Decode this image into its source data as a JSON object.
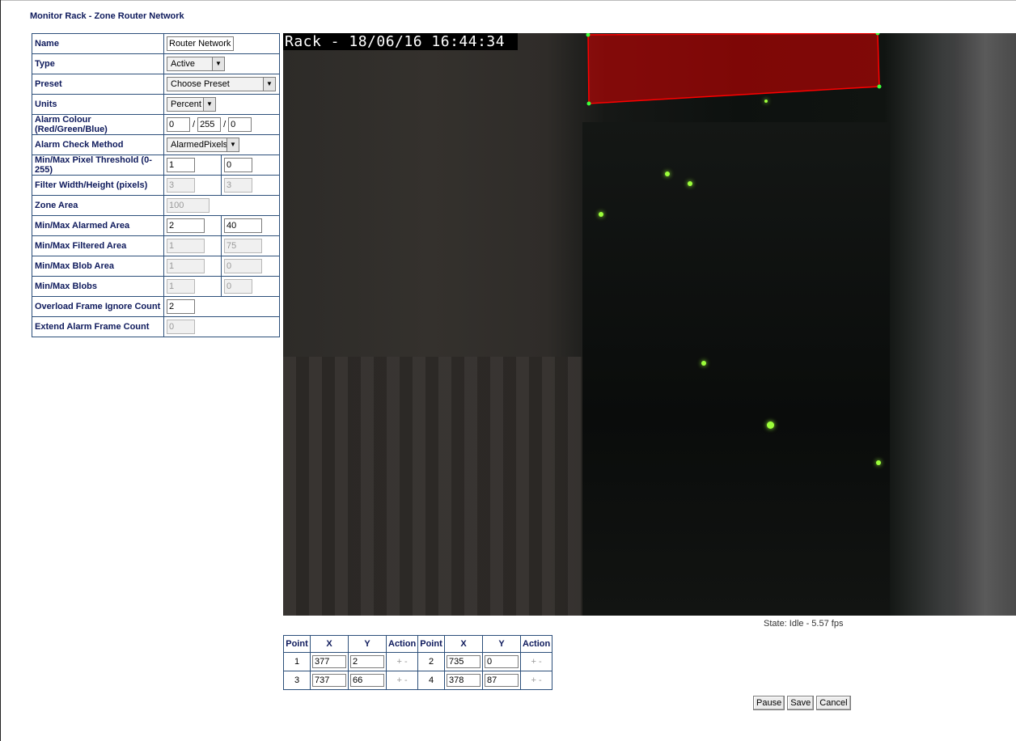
{
  "page_title": "Monitor Rack - Zone Router Network",
  "settings": {
    "name": {
      "label": "Name",
      "value": "Router Network"
    },
    "type": {
      "label": "Type",
      "value": "Active"
    },
    "preset": {
      "label": "Preset",
      "value": "Choose Preset"
    },
    "units": {
      "label": "Units",
      "value": "Percent"
    },
    "alarm_colour": {
      "label": "Alarm Colour (Red/Green/Blue)",
      "r": "0",
      "g": "255",
      "b": "0",
      "sep": "/"
    },
    "alarm_check": {
      "label": "Alarm Check Method",
      "value": "AlarmedPixels"
    },
    "pixel_threshold": {
      "label": "Min/Max Pixel Threshold (0-255)",
      "min": "1",
      "max": "0"
    },
    "filter_size": {
      "label": "Filter Width/Height (pixels)",
      "width": "3",
      "height": "3"
    },
    "zone_area": {
      "label": "Zone Area",
      "value": "100"
    },
    "alarmed_area": {
      "label": "Min/Max Alarmed Area",
      "min": "2",
      "max": "40"
    },
    "filtered_area": {
      "label": "Min/Max Filtered Area",
      "min": "1",
      "max": "75"
    },
    "blob_area": {
      "label": "Min/Max Blob Area",
      "min": "1",
      "max": "0"
    },
    "blobs": {
      "label": "Min/Max Blobs",
      "min": "1",
      "max": "0"
    },
    "overload_ignore": {
      "label": "Overload Frame Ignore Count",
      "value": "2"
    },
    "extend_alarm": {
      "label": "Extend Alarm Frame Count",
      "value": "0"
    }
  },
  "camera": {
    "timestamp": "Rack - 18/06/16 16:44:34",
    "zone_color": "#ff0000",
    "state": "State: Idle - 5.57 fps"
  },
  "points": {
    "headers": {
      "point": "Point",
      "x": "X",
      "y": "Y",
      "action": "Action"
    },
    "rows": [
      {
        "point": "1",
        "x": "377",
        "y": "2",
        "action": "+ -"
      },
      {
        "point": "3",
        "x": "737",
        "y": "66",
        "action": "+ -"
      },
      {
        "point": "2",
        "x": "735",
        "y": "0",
        "action": "+ -"
      },
      {
        "point": "4",
        "x": "378",
        "y": "87",
        "action": "+ -"
      }
    ]
  },
  "buttons": {
    "pause": "Pause",
    "save": "Save",
    "cancel": "Cancel"
  }
}
